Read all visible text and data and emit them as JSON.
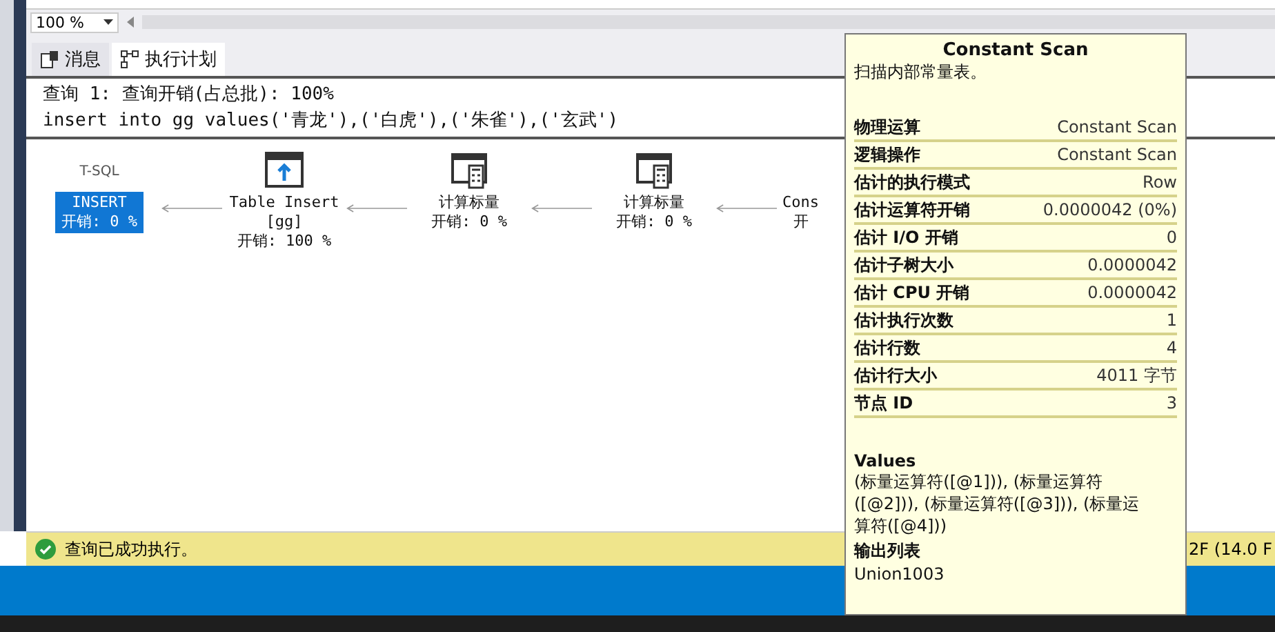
{
  "zoom": {
    "value": "100 %"
  },
  "tabs": [
    {
      "label": "消息",
      "selected": false
    },
    {
      "label": "执行计划",
      "selected": true
    }
  ],
  "query": {
    "header": "查询 1: 查询开销(占总批): 100%",
    "sql": "insert into gg values('青龙'),('白虎'),('朱雀'),('玄武')"
  },
  "plan": {
    "nodes": [
      {
        "kind": "statement",
        "caption": "T-SQL",
        "label": "INSERT",
        "cost": "开销: 0 %",
        "selected": true
      },
      {
        "kind": "insert",
        "label": "Table Insert",
        "sublabel": "[gg]",
        "cost": "开销: 100 %",
        "selected": false
      },
      {
        "kind": "scalar",
        "label": "计算标量",
        "cost": "开销: 0 %",
        "selected": false
      },
      {
        "kind": "scalar",
        "label": "计算标量",
        "cost": "开销: 0 %",
        "selected": false
      },
      {
        "kind": "partial",
        "label": "Cons",
        "cost": "开",
        "selected": false
      }
    ]
  },
  "tooltip": {
    "title": "Constant Scan",
    "description": "扫描内部常量表。",
    "properties": [
      {
        "name": "物理运算",
        "value": "Constant Scan"
      },
      {
        "name": "逻辑操作",
        "value": "Constant Scan"
      },
      {
        "name": "估计的执行模式",
        "value": "Row"
      },
      {
        "name": "估计运算符开销",
        "value": "0.0000042 (0%)"
      },
      {
        "name": "估计 I/O 开销",
        "value": "0"
      },
      {
        "name": "估计子树大小",
        "value": "0.0000042"
      },
      {
        "name": "估计 CPU 开销",
        "value": "0.0000042"
      },
      {
        "name": "估计执行次数",
        "value": "1"
      },
      {
        "name": "估计行数",
        "value": "4"
      },
      {
        "name": "估计行大小",
        "value": "4011 字节"
      },
      {
        "name": "节点 ID",
        "value": "3"
      }
    ],
    "sections": [
      {
        "heading": "Values",
        "text": "(标量运算符([@1])), (标量运算符([@2])), (标量运算符([@3])), (标量运算符([@4]))"
      },
      {
        "heading": "输出列表",
        "text": "Union1003"
      }
    ]
  },
  "status_bar": {
    "message": "查询已成功执行。",
    "right": "2F (14.0 F"
  }
}
